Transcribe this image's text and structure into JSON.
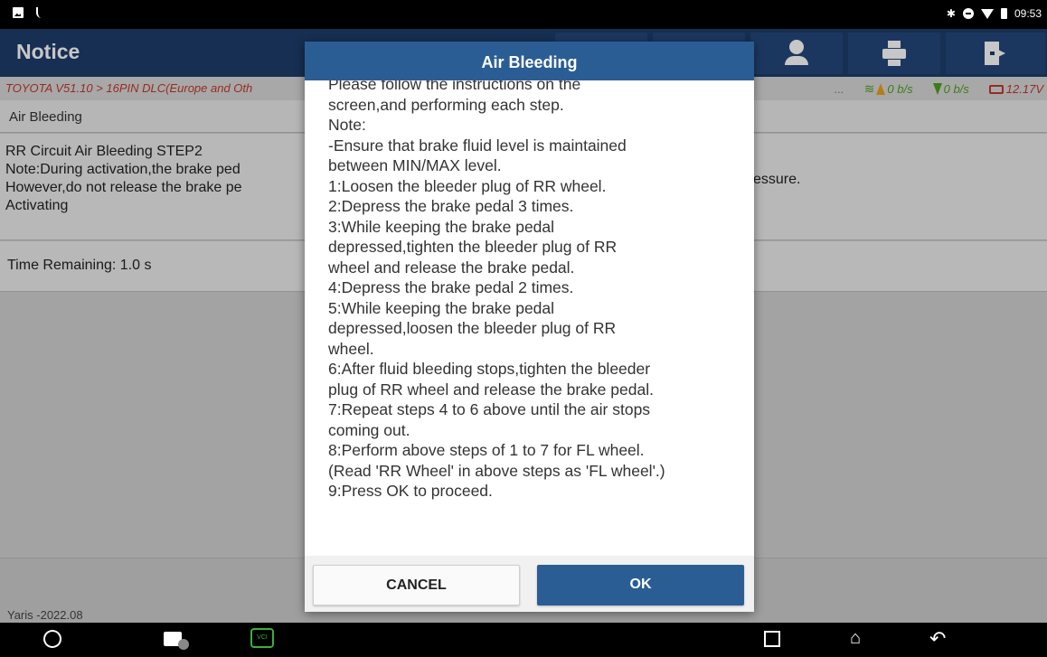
{
  "status_bar": {
    "time": "09:53",
    "icons": [
      "gallery-icon",
      "usb-icon",
      "bluetooth-icon",
      "dnd-icon",
      "wifi-icon",
      "battery-icon"
    ]
  },
  "header": {
    "title": "Notice",
    "toolbar_icons": [
      "support-person-icon",
      "printer-icon",
      "exit-icon"
    ]
  },
  "info_bar": {
    "path": "TOYOTA V51.10 > 16PIN DLC(Europe and Oth",
    "truncated_mid": "...",
    "upload_speed": "0 b/s",
    "download_speed": "0 b/s",
    "voltage": "12.17V"
  },
  "main": {
    "section_label": "Air Bleeding",
    "step_lines": [
      "RR Circuit Air Bleeding STEP2",
      "Note:During activation,the brake ped",
      "However,do not release the brake pe",
      "Activating"
    ],
    "step_right_fragment": "essure.",
    "time_remaining": "Time Remaining: 1.0 s",
    "vehicle": "Yaris -2022.08"
  },
  "dialog": {
    "title": "Air Bleeding",
    "lines": [
      "Please follow the instructions on the",
      "screen,and performing each step.",
      "Note:",
      "-Ensure that brake fluid level is maintained",
      "between MIN/MAX level.",
      "1:Loosen the bleeder plug of RR wheel.",
      "2:Depress the brake pedal 3 times.",
      "3:While keeping the brake pedal",
      "depressed,tighten the bleeder plug of RR",
      "wheel and release the brake pedal.",
      "4:Depress the brake pedal 2 times.",
      "5:While keeping the brake pedal",
      "depressed,loosen the bleeder plug of RR",
      "wheel.",
      "6:After fluid bleeding stops,tighten the bleeder",
      "plug of RR wheel and release the brake pedal.",
      "7:Repeat steps 4 to 6 above until the air stops",
      "coming out.",
      "8:Perform above steps of 1 to 7 for FL wheel.",
      "(Read 'RR Wheel' in above steps as 'FL wheel'.)",
      "9:Press OK to proceed."
    ],
    "cancel_label": "CANCEL",
    "ok_label": "OK"
  },
  "nav_bar": {
    "vci_label": "VCI",
    "home_glyph": "⌂",
    "back_glyph": "↶"
  }
}
